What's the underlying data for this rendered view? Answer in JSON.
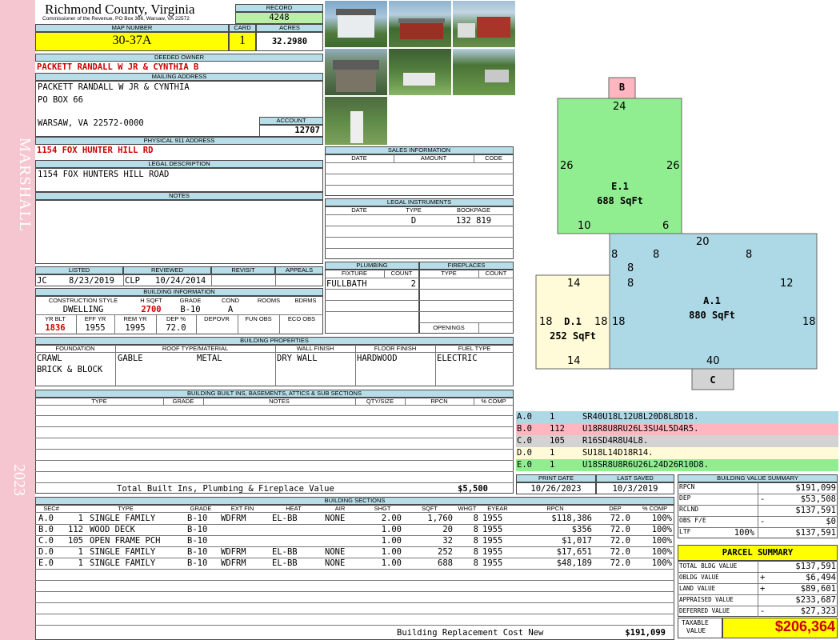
{
  "sidebar": {
    "district": "MARSHALL",
    "year": "2023"
  },
  "county": {
    "name": "Richmond County, Virginia",
    "commissioner": "Commissioner of the Revenue, PO Box 366, Warsaw, VA 22572"
  },
  "labels": {
    "record": "RECORD",
    "map_number": "MAP NUMBER",
    "card": "CARD",
    "acres": "ACRES",
    "deeded_owner": "DEEDED OWNER",
    "mailing_address": "MAILING ADDRESS",
    "account": "ACCOUNT",
    "physical_address": "PHYSICAL 911 ADDRESS",
    "legal_description": "LEGAL DESCRIPTION",
    "notes": "NOTES",
    "listed": "LISTED",
    "reviewed": "REVIEWED",
    "revisit": "REVISIT",
    "appeals": "APPEALS",
    "building_information": "BUILDING INFORMATION",
    "construction_style": "CONSTRUCTION STYLE",
    "h_sqft": "H SQFT",
    "grade": "GRADE",
    "cond": "COND",
    "rooms": "ROOMS",
    "bdrms": "BDRMS",
    "yr_blt": "YR BLT",
    "eff_yr": "EFF YR",
    "rem_yr": "REM YR",
    "dep_pct": "DEP %",
    "depovr": "DEPOVR",
    "fun_obs": "FUN OBS",
    "eco_obs": "ECO OBS",
    "building_properties": "BUILDING PROPERTIES",
    "foundation": "FOUNDATION",
    "roof": "ROOF TYPE/MATERIAL",
    "wall": "WALL FINISH",
    "floor": "FLOOR FINISH",
    "fuel": "FUEL TYPE",
    "builtins_title": "BUILDING BUILT INS, BASEMENTS, ATTICS & SUB SECTIONS",
    "bi_type": "TYPE",
    "bi_grade": "GRADE",
    "bi_notes": "NOTES",
    "bi_qty": "QTY/SIZE",
    "bi_rpcn": "RPCN",
    "bi_comp": "% COMP",
    "total_builtins": "Total Built Ins, Plumbing & Fireplace Value",
    "sales_information": "SALES INFORMATION",
    "s_date": "DATE",
    "s_amount": "AMOUNT",
    "s_code": "CODE",
    "legal_instruments": "LEGAL INSTRUMENTS",
    "li_date": "DATE",
    "li_type": "TYPE",
    "li_bookpage": "BOOKPAGE",
    "plumbing": "PLUMBING",
    "fixture": "FIXTURE",
    "count": "COUNT",
    "fireplaces": "FIREPLACES",
    "fp_type": "TYPE",
    "fp_count": "COUNT",
    "openings": "OPENINGS",
    "print_date": "PRINT DATE",
    "last_saved": "LAST SAVED",
    "building_sections": "BUILDING SECTIONS",
    "bs_sec": "SEC#",
    "bs_type": "TYPE",
    "bs_grade": "GRADE",
    "bs_extfin": "EXT FIN",
    "bs_heat": "HEAT",
    "bs_air": "AIR",
    "bs_shgt": "SHGT",
    "bs_sqft": "SQFT",
    "bs_whgt": "WHGT",
    "bs_eyear": "EYEAR",
    "bs_rpcn": "RPCN",
    "bs_dep": "DEP",
    "bs_comp": "% COMP",
    "replacement_cost": "Building Replacement Cost New",
    "bvs_title": "BUILDING VALUE SUMMARY",
    "parcel_summary": "PARCEL SUMMARY",
    "taxable": "TAXABLE",
    "value": "VALUE"
  },
  "record": "4248",
  "map_number": "30-37A",
  "card": "1",
  "acres": "32.2980",
  "deeded_owner": "PACKETT RANDALL W JR & CYNTHIA B",
  "mailing": {
    "line1": "PACKETT RANDALL W JR & CYNTHIA",
    "line2": "PO BOX 66",
    "line3": "WARSAW, VA 22572-0000"
  },
  "account": "12707",
  "physical_address": "1154 FOX HUNTER HILL RD",
  "legal_description": "1154 FOX HUNTERS HILL ROAD",
  "listed": {
    "by": "JC",
    "date": "8/23/2019"
  },
  "reviewed": {
    "by": "CLP",
    "date": "10/24/2014"
  },
  "building": {
    "construction_style": "DWELLING",
    "h_sqft": "2700",
    "grade": "B-10",
    "cond": "A",
    "yr_blt": "1836",
    "eff_yr": "1955",
    "rem_yr": "1995",
    "dep_pct": "72.0"
  },
  "properties": {
    "foundation1": "CRAWL",
    "foundation2": "BRICK & BLOCK",
    "roof_type": "GABLE",
    "roof_material": "METAL",
    "wall": "DRY WALL",
    "floor": "HARDWOOD",
    "fuel": "ELECTRIC"
  },
  "total_builtins_value": "$5,500",
  "legal_instrument": {
    "type": "D",
    "bookpage": "132 819"
  },
  "plumbing": {
    "fixture": "FULLBATH",
    "count": "2"
  },
  "print_date": "10/26/2023",
  "last_saved": "10/3/2019",
  "sketch": {
    "B": {
      "name": "B"
    },
    "E": {
      "name": "E.1",
      "area": "688 SqFt"
    },
    "A": {
      "name": "A.1",
      "area": "880 SqFt"
    },
    "D": {
      "name": "D.1",
      "area": "252 SqFt"
    },
    "C": {
      "name": "C"
    },
    "dims": [
      "24",
      "26",
      "26",
      "10",
      "6",
      "20",
      "8",
      "8",
      "8",
      "8",
      "8",
      "12",
      "14",
      "8",
      "18",
      "18",
      "18",
      "18",
      "14",
      "40"
    ]
  },
  "sketch_codes": [
    {
      "sec": "A.0",
      "num": "1",
      "code": "SR40U18L12U8L20D8L8D18.",
      "color": "#add8e6"
    },
    {
      "sec": "B.0",
      "num": "112",
      "code": "U18R8U8RU26L3SU4L5D4R5.",
      "color": "#ffb6c1"
    },
    {
      "sec": "C.0",
      "num": "105",
      "code": "R16SD4R8U4L8.",
      "color": "#d3d3d3"
    },
    {
      "sec": "D.0",
      "num": "1",
      "code": "SU18L14D18R14.",
      "color": "#fffbd8"
    },
    {
      "sec": "E.0",
      "num": "1",
      "code": "U18SR8U8R6U26L24D26R10D8.",
      "color": "#90ee90"
    }
  ],
  "sections": [
    {
      "sec": "A.0",
      "num": "1",
      "type": "SINGLE FAMILY",
      "grade": "B-10",
      "extfin": "WDFRM",
      "heat": "EL-BB",
      "air": "NONE",
      "shgt": "2.00",
      "sqft": "1,760",
      "whgt": "8",
      "eyear": "1955",
      "rpcn": "$118,386",
      "dep": "72.0",
      "comp": "100%"
    },
    {
      "sec": "B.0",
      "num": "112",
      "type": "WOOD DECK",
      "grade": "B-10",
      "extfin": "",
      "heat": "",
      "air": "",
      "shgt": "1.00",
      "sqft": "20",
      "whgt": "8",
      "eyear": "1955",
      "rpcn": "$356",
      "dep": "72.0",
      "comp": "100%"
    },
    {
      "sec": "C.0",
      "num": "105",
      "type": "OPEN FRAME PCH",
      "grade": "B-10",
      "extfin": "",
      "heat": "",
      "air": "",
      "shgt": "1.00",
      "sqft": "32",
      "whgt": "8",
      "eyear": "1955",
      "rpcn": "$1,017",
      "dep": "72.0",
      "comp": "100%"
    },
    {
      "sec": "D.0",
      "num": "1",
      "type": "SINGLE FAMILY",
      "grade": "B-10",
      "extfin": "WDFRM",
      "heat": "EL-BB",
      "air": "NONE",
      "shgt": "1.00",
      "sqft": "252",
      "whgt": "8",
      "eyear": "1955",
      "rpcn": "$17,651",
      "dep": "72.0",
      "comp": "100%"
    },
    {
      "sec": "E.0",
      "num": "1",
      "type": "SINGLE FAMILY",
      "grade": "B-10",
      "extfin": "WDFRM",
      "heat": "EL-BB",
      "air": "NONE",
      "shgt": "1.00",
      "sqft": "688",
      "whgt": "8",
      "eyear": "1955",
      "rpcn": "$48,189",
      "dep": "72.0",
      "comp": "100%"
    }
  ],
  "replacement_cost": "$191,099",
  "bvs": [
    {
      "label": "RPCN",
      "sign": "",
      "value": "$191,099"
    },
    {
      "label": "DEP",
      "sign": "-",
      "value": "$53,508"
    },
    {
      "label": "RCLND",
      "sign": "",
      "value": "$137,591"
    },
    {
      "label": "OBS F/E",
      "sign": "-",
      "value": "$0"
    },
    {
      "label": "LTF",
      "pct": "100%",
      "sign": "",
      "value": "$137,591"
    }
  ],
  "parcel": [
    {
      "label": "TOTAL BLDG VALUE",
      "sign": "",
      "value": "$137,591"
    },
    {
      "label": "OBLDG VALUE",
      "sign": "+",
      "value": "$6,494"
    },
    {
      "label": "LAND VALUE",
      "sign": "+",
      "value": "$89,601"
    },
    {
      "label": "APPRAISED VALUE",
      "sign": "",
      "value": "$233,687"
    },
    {
      "label": "DEFERRED VALUE",
      "sign": "-",
      "value": "$27,323"
    }
  ],
  "taxable_value": "$206,364",
  "colors": {
    "header": "#b7dde8",
    "highlight": "#ffff00",
    "record": "#b9f0a8",
    "red": "#cc0000",
    "sidebar": "#f6c6d0"
  }
}
